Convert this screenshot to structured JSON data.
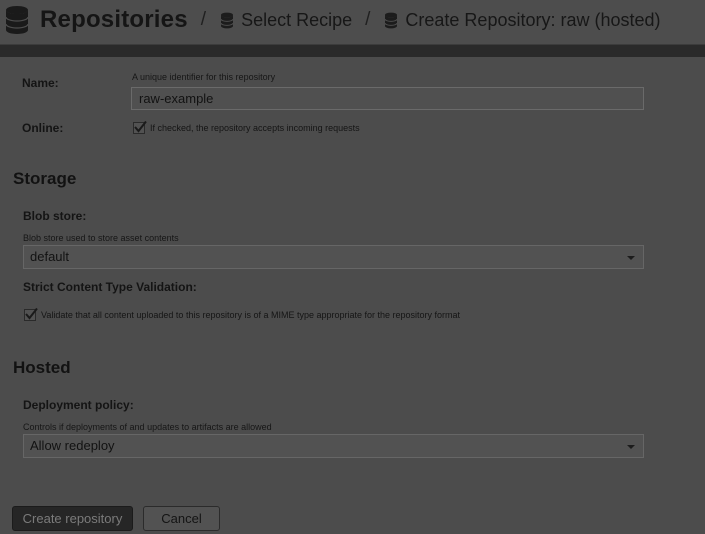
{
  "breadcrumb": {
    "title": "Repositories",
    "separator": "/",
    "items": [
      "Select Recipe",
      "Create Repository: raw (hosted)"
    ],
    "icon": "database-icon"
  },
  "form": {
    "name": {
      "label": "Name:",
      "help": "A unique identifier for this repository",
      "value": "raw-example"
    },
    "online": {
      "label": "Online:",
      "checked": true,
      "text": "If checked, the repository accepts incoming requests"
    },
    "storage": {
      "title": "Storage",
      "blob_store": {
        "label": "Blob store:",
        "help": "Blob store used to store asset contents",
        "value": "default"
      },
      "strict": {
        "label": "Strict Content Type Validation:",
        "checked": true,
        "text": "Validate that all content uploaded to this repository is of a MIME type appropriate for the repository format"
      }
    },
    "hosted": {
      "title": "Hosted",
      "deployment": {
        "label": "Deployment policy:",
        "help": "Controls if deployments of and updates to artifacts are allowed",
        "value": "Allow redeploy"
      }
    }
  },
  "buttons": {
    "create": "Create repository",
    "cancel": "Cancel"
  }
}
